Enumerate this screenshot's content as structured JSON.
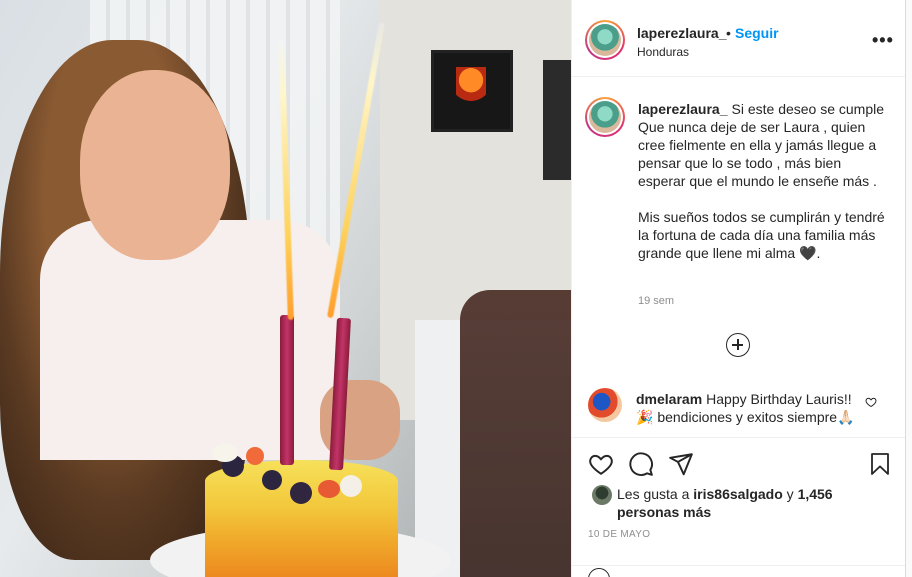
{
  "post": {
    "username": "laperezlaura_",
    "follow_separator": "•",
    "follow_label": "Seguir",
    "location": "Honduras",
    "more_label": "•••"
  },
  "caption": {
    "username": "laperezlaura_",
    "paragraph1": "Si este deseo se cumple Que nunca deje de ser Laura , quien cree fielmente en ella y jamás llegue a pensar que lo se todo , más bien esperar que el mundo le enseñe más .",
    "paragraph2": "Mis sueños todos se cumplirán y tendré la fortuna de cada día una familia más grande que llene mi alma 🖤.",
    "time_ago": "19 sem"
  },
  "comment": {
    "username": "dmelaram",
    "text": "Happy Birthday Lauris!! 🎉 bendiciones y exitos siempre🙏🏻"
  },
  "likes": {
    "prefix": "Les gusta a",
    "liker": "iris86salgado",
    "connector": "y",
    "count_text": "1,456 personas más"
  },
  "date": "10 DE MAYO",
  "icons": {
    "like": "heart-icon",
    "comment": "comment-icon",
    "share": "send-icon",
    "save": "bookmark-icon",
    "more": "more-options-icon",
    "load_more": "plus-circle-icon"
  },
  "colors": {
    "follow": "#0095f6",
    "text": "#262626",
    "muted": "#8e8e8e",
    "border": "#efefef"
  }
}
